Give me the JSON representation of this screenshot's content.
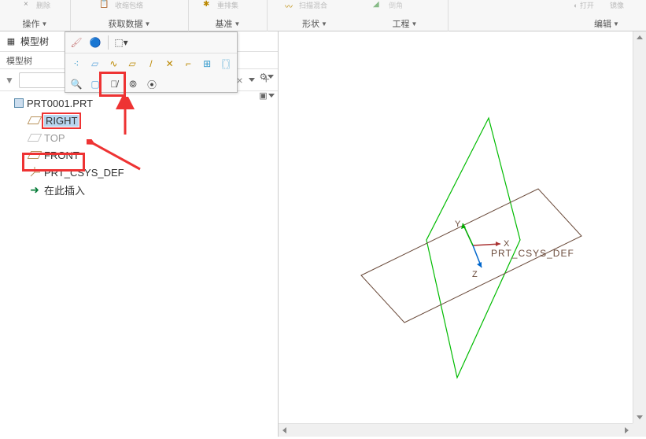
{
  "ribbon": {
    "groups": [
      {
        "label": "操作",
        "arrow": true,
        "icon": "×"
      },
      {
        "label": "获取数据",
        "arrow": true,
        "icon": "📋"
      },
      {
        "label": "基准",
        "arrow": true,
        "icon": "🔨"
      },
      {
        "label": "形状",
        "arrow": true,
        "icon": "◇"
      },
      {
        "label": "工程",
        "arrow": true,
        "icon": "⚙"
      },
      {
        "label": "编辑",
        "arrow": true,
        "icon": "✎"
      }
    ],
    "top_hints": [
      "删除",
      "收缩包络",
      "重排集",
      "扫描混合",
      "倒角",
      "打开",
      "镜像"
    ]
  },
  "sidebar": {
    "title": "模型树",
    "sub_title": "模型树",
    "filter_placeholder": ""
  },
  "tree": {
    "root": "PRT0001.PRT",
    "items": [
      {
        "label": "RIGHT",
        "type": "plane",
        "selected": true
      },
      {
        "label": "TOP",
        "type": "plane",
        "hidden": true
      },
      {
        "label": "FRONT",
        "type": "plane"
      },
      {
        "label": "PRT_CSYS_DEF",
        "type": "csys"
      },
      {
        "label": "在此插入",
        "type": "insert"
      }
    ]
  },
  "viewport": {
    "csys_label": "PRT_CSYS_DEF",
    "axes": {
      "x": "X",
      "y": "Y",
      "z": "Z"
    }
  }
}
